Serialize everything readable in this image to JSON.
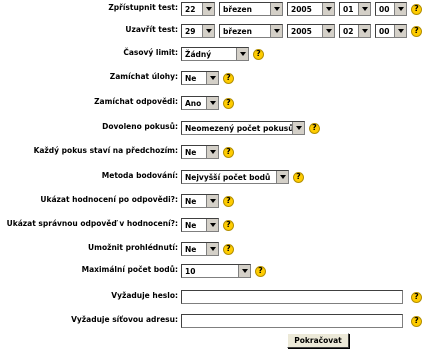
{
  "fields": {
    "open": {
      "label": "Zpřístupnit test:",
      "day": "22",
      "month": "březen",
      "year": "2005",
      "hour": "01",
      "minute": "00"
    },
    "close": {
      "label": "Uzavřít test:",
      "day": "29",
      "month": "březen",
      "year": "2005",
      "hour": "02",
      "minute": "00"
    },
    "time_limit": {
      "label": "Časový limit:",
      "value": "Žádný"
    },
    "shuffle_questions": {
      "label": "Zamíchat úlohy:",
      "value": "Ne"
    },
    "shuffle_answers": {
      "label": "Zamíchat odpovědi:",
      "value": "Ano"
    },
    "attempts": {
      "label": "Dovoleno pokusů:",
      "value": "Neomezený počet pokusů"
    },
    "build_on_last": {
      "label": "Každý pokus staví na předchozím:",
      "value": "Ne"
    },
    "grading_method": {
      "label": "Metoda bodování:",
      "value": "Nejvyšší počet bodů"
    },
    "feedback": {
      "label": "Ukázat hodnocení po odpovědi?:",
      "value": "Ne"
    },
    "show_answer": {
      "label": "Ukázat správnou odpověď v hodnocení?:",
      "value": "Ne"
    },
    "review": {
      "label": "Umožnit prohlédnutí:",
      "value": "Ne"
    },
    "max_grade": {
      "label": "Maximální počet bodů:",
      "value": "10"
    },
    "password": {
      "label": "Vyžaduje heslo:",
      "value": ""
    },
    "subnet": {
      "label": "Vyžaduje síťovou adresu:",
      "value": ""
    }
  },
  "help_glyph": "?",
  "continue_label": "Pokračovat",
  "colors": {
    "help_icon": "#ffcc00",
    "button_face": "#ece9d8"
  }
}
